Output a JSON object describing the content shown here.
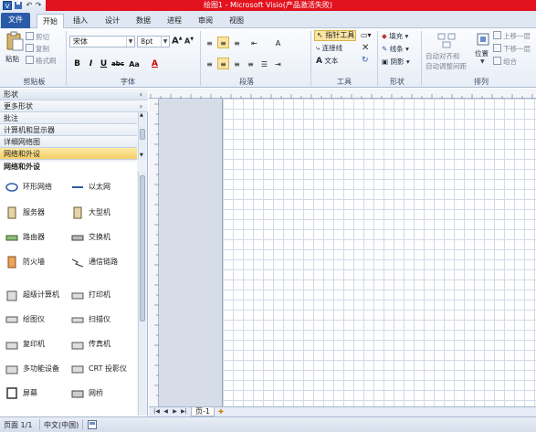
{
  "titlebar": {
    "title": "绘图1 - Microsoft Visio(产品激活失败)",
    "quick_access": [
      "save-icon",
      "undo-icon",
      "redo-icon",
      "customize-icon"
    ]
  },
  "tabs": {
    "file": "文件",
    "items": [
      "开始",
      "插入",
      "设计",
      "数据",
      "进程",
      "审阅",
      "视图"
    ],
    "active": "开始"
  },
  "ribbon": {
    "clipboard": {
      "paste": "粘贴",
      "cut": "剪切",
      "copy": "复制",
      "format_painter": "格式刷",
      "label": "剪贴板"
    },
    "font": {
      "font_name": "宋体",
      "font_size": "8pt",
      "grow": "A",
      "shrink": "A",
      "bold": "B",
      "italic": "I",
      "underline": "U",
      "strike": "abc",
      "case": "Aa",
      "color": "A",
      "label": "字体"
    },
    "paragraph": {
      "label": "段落"
    },
    "tools": {
      "pointer": "指针工具",
      "connector": "连接线",
      "text": "文本",
      "label": "工具"
    },
    "shape": {
      "fill": "填充",
      "line": "线条",
      "shadow": "阴影",
      "label": "形状"
    },
    "arrange": {
      "auto_align": "自动对齐和",
      "auto_align2": "自动调整间距",
      "position": "位置",
      "bring_forward": "上移一层",
      "send_backward": "下移一层",
      "group": "组合",
      "label": "排列"
    }
  },
  "shapes_pane": {
    "title": "形状",
    "more_shapes": "更多形状",
    "stencils": [
      "批注",
      "计算机和显示器",
      "详细网络图",
      "网络和外设"
    ],
    "selected_stencil": "网络和外设",
    "section_title": "网络和外设",
    "items": [
      {
        "label": "环形网络",
        "icon": "ring-network-icon"
      },
      {
        "label": "以太网",
        "icon": "ethernet-icon"
      },
      {
        "label": "服务器",
        "icon": "server-icon"
      },
      {
        "label": "大型机",
        "icon": "mainframe-icon"
      },
      {
        "label": "路由器",
        "icon": "router-icon"
      },
      {
        "label": "交换机",
        "icon": "switch-icon"
      },
      {
        "label": "防火墙",
        "icon": "firewall-icon"
      },
      {
        "label": "通信链路",
        "icon": "comm-link-icon"
      },
      {
        "label": "超级计算机",
        "icon": "supercomputer-icon"
      },
      {
        "label": "打印机",
        "icon": "printer-icon"
      },
      {
        "label": "绘图仪",
        "icon": "plotter-icon"
      },
      {
        "label": "扫描仪",
        "icon": "scanner-icon"
      },
      {
        "label": "复印机",
        "icon": "copier-icon"
      },
      {
        "label": "传真机",
        "icon": "fax-icon"
      },
      {
        "label": "多功能设备",
        "icon": "multifunction-device-icon"
      },
      {
        "label": "CRT 投影仪",
        "icon": "crt-projector-icon"
      },
      {
        "label": "屏幕",
        "icon": "screen-icon"
      },
      {
        "label": "网桥",
        "icon": "bridge-icon"
      }
    ]
  },
  "pagetabs": {
    "page": "页-1"
  },
  "status": {
    "page_info": "页面 1/1",
    "language": "中文(中国)"
  },
  "colors": {
    "title_red": "#e2121e",
    "file_tab": "#2b5aa8",
    "selected_stencil": "#f6cf62"
  }
}
